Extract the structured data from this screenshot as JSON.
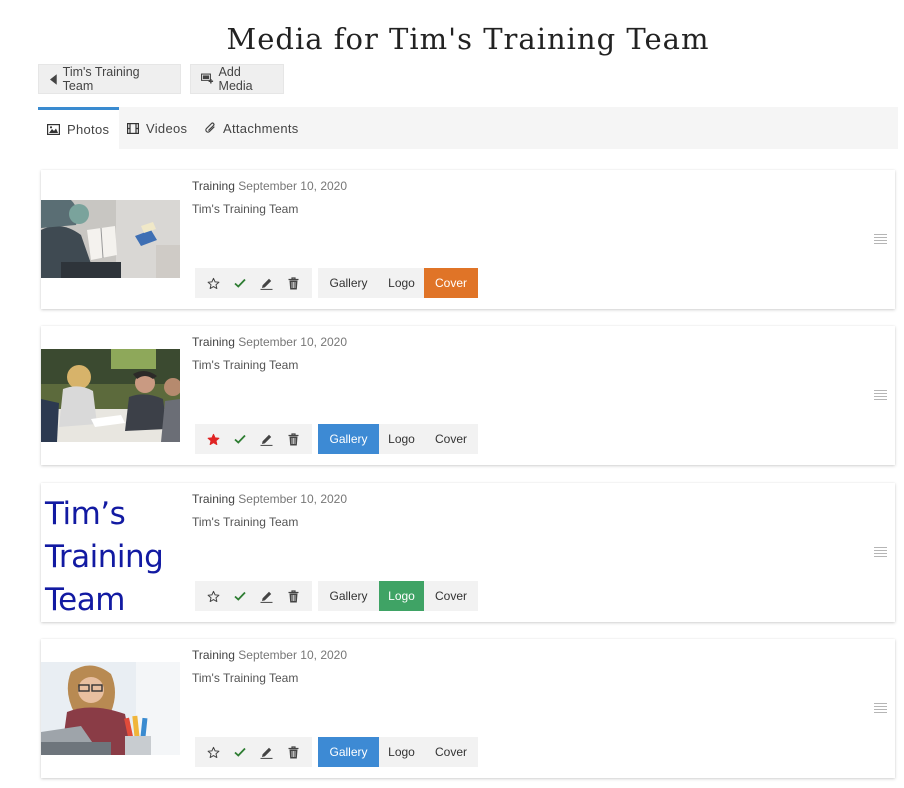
{
  "page": {
    "title": "Media for Tim's Training Team"
  },
  "toolbar": {
    "back_label": "Tim's Training Team",
    "add_label": "Add Media"
  },
  "tabs": [
    {
      "label": "Photos",
      "active": true
    },
    {
      "label": "Videos",
      "active": false
    },
    {
      "label": "Attachments",
      "active": false
    }
  ],
  "segment_labels": {
    "gallery": "Gallery",
    "logo": "Logo",
    "cover": "Cover"
  },
  "logo_text": "Tim’s Training Team",
  "cards": [
    {
      "category": "Training",
      "date": "September 10, 2020",
      "team": "Tim's Training Team",
      "featured": false,
      "selected": "Cover"
    },
    {
      "category": "Training",
      "date": "September 10, 2020",
      "team": "Tim's Training Team",
      "featured": true,
      "selected": "Gallery"
    },
    {
      "category": "Training",
      "date": "September 10, 2020",
      "team": "Tim's Training Team",
      "featured": false,
      "selected": "Logo"
    },
    {
      "category": "Training",
      "date": "September 10, 2020",
      "team": "Tim's Training Team",
      "featured": false,
      "selected": "Gallery"
    }
  ],
  "colors": {
    "accent_blue": "#3d8ad4",
    "logo_green": "#3fa365",
    "cover_orange": "#e07427",
    "star_red": "#e02424",
    "check_green": "#2e7d32",
    "logo_text_blue": "#121aa2"
  },
  "icons": [
    "caret-left-icon",
    "add-media-icon",
    "image-icon",
    "film-icon",
    "paperclip-icon",
    "star-icon",
    "check-icon",
    "edit-icon",
    "trash-icon",
    "drag-handle-icon"
  ]
}
